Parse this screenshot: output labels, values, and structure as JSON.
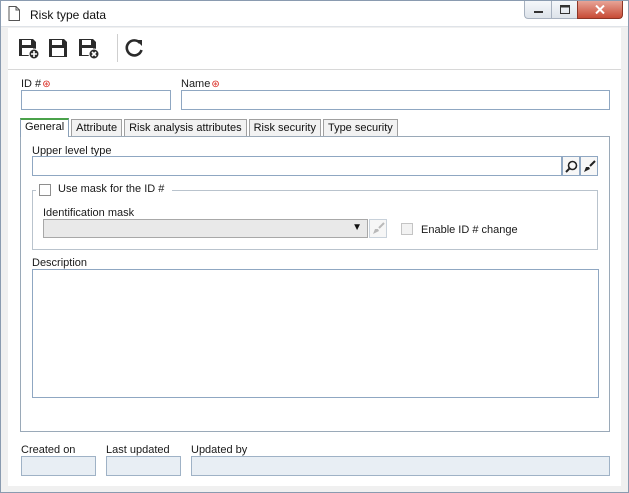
{
  "window": {
    "title": "Risk type data",
    "controls": {
      "minimize": "minimize",
      "maximize": "maximize",
      "close": "close"
    }
  },
  "toolbar": {
    "buttons": [
      {
        "name": "save-and-new",
        "icon": "save-new-icon"
      },
      {
        "name": "save",
        "icon": "save-icon"
      },
      {
        "name": "save-and-close",
        "icon": "save-close-icon"
      },
      {
        "name": "refresh",
        "icon": "refresh-icon"
      }
    ]
  },
  "form": {
    "id_label": "ID #",
    "id_value": "",
    "name_label": "Name",
    "name_value": "",
    "required_marker": "⊛"
  },
  "tabs": [
    "General",
    "Attribute",
    "Risk analysis attributes",
    "Risk security",
    "Type security"
  ],
  "active_tab": 0,
  "general": {
    "upper_level_label": "Upper level type",
    "upper_level_value": "",
    "use_mask_label": "Use mask for the ID #",
    "use_mask_checked": false,
    "identification_mask_label": "Identification mask",
    "identification_mask_value": "",
    "enable_id_change_label": "Enable ID # change",
    "enable_id_change_checked": false,
    "description_label": "Description",
    "description_value": ""
  },
  "footer": {
    "created_on_label": "Created on",
    "created_on_value": "",
    "last_updated_label": "Last updated",
    "last_updated_value": "",
    "updated_by_label": "Updated by",
    "updated_by_value": ""
  },
  "colors": {
    "accent_tab": "#4aa24a",
    "required": "#d9261c",
    "close_button": "#c74b35",
    "input_border": "#8fa7c2"
  }
}
